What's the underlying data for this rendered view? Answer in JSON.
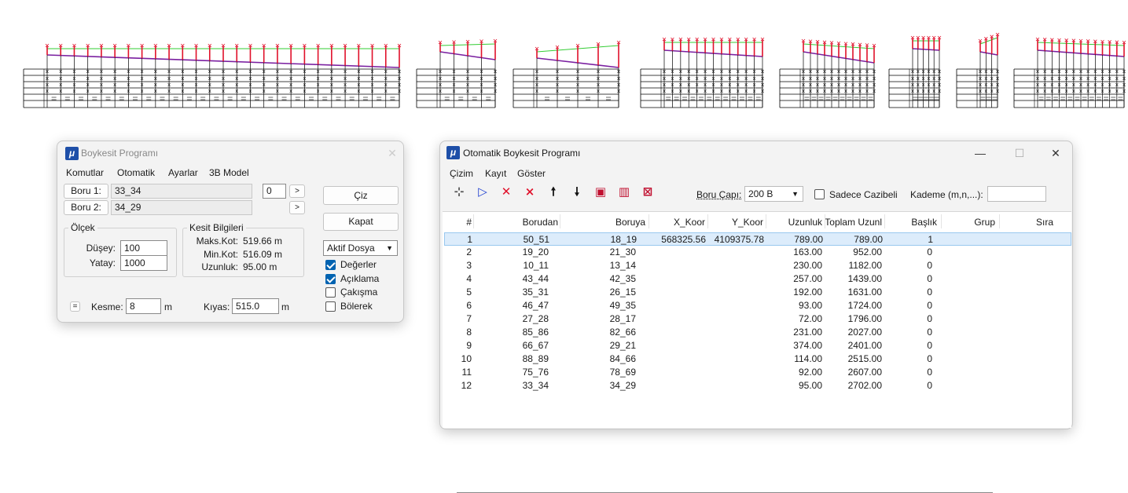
{
  "cad": {
    "line_color_terrain": "#33cc33",
    "line_color_pipe": "#7a1fa0",
    "marker_color": "#e0102a"
  },
  "boykesit": {
    "title": "Boykesit Programı",
    "icon_letter": "μ",
    "close_glyph": "✕",
    "menu": [
      "Komutlar",
      "Otomatik",
      "Ayarlar",
      "3B Model"
    ],
    "boru1_label": "Boru 1:",
    "boru1_value": "33_34",
    "boru2_label": "Boru 2:",
    "boru2_value": "34_29",
    "counter_value": "0",
    "next_glyph": ">",
    "ciz": "Çiz",
    "kapat": "Kapat",
    "olcek": {
      "title": "Ölçek",
      "duse_label": "Düşey:",
      "duse_value": "100",
      "yatay_label": "Yatay:",
      "yatay_value": "1000"
    },
    "kesit": {
      "title": "Kesit Bilgileri",
      "maks_label": "Maks.Kot:",
      "maks_value": "519.66 m",
      "min_label": "Min.Kot:",
      "min_value": "516.09 m",
      "uzun_label": "Uzunluk:",
      "uzun_value": "95.00 m"
    },
    "file_select": "Aktif Dosya",
    "checks": [
      {
        "label": "Değerler",
        "checked": true
      },
      {
        "label": "Açıklama",
        "checked": true
      },
      {
        "label": "Çakışma",
        "checked": false
      },
      {
        "label": "Bölerek",
        "checked": false
      }
    ],
    "eq_glyph": "=",
    "kesme_label": "Kesme:",
    "kesme_value": "8",
    "kesme_unit": "m",
    "kiyas_label": "Kıyas:",
    "kiyas_value": "515.0",
    "kiyas_unit": "m"
  },
  "otomatik": {
    "title": "Otomatik Boykesit Programı",
    "icon_letter": "μ",
    "min_glyph": "—",
    "max_glyph": "☐",
    "close_glyph": "✕",
    "menu": [
      "Çizim",
      "Kayıt",
      "Göster"
    ],
    "toolbar_icons": [
      {
        "name": "crosshair-icon",
        "glyph": "⊹",
        "color": "#555555"
      },
      {
        "name": "play-icon",
        "glyph": "▷",
        "color": "#1f3fd0"
      },
      {
        "name": "delete-x-icon",
        "glyph": "✕",
        "color": "#e0102a"
      },
      {
        "name": "delete-all-icon",
        "glyph": "⨯",
        "color": "#e0102a"
      },
      {
        "name": "arrow-up-icon",
        "glyph": "🠕",
        "color": "#111111"
      },
      {
        "name": "arrow-down-icon",
        "glyph": "🠗",
        "color": "#111111"
      },
      {
        "name": "profile-icon",
        "glyph": "▣",
        "color": "#c01030"
      },
      {
        "name": "profile-multi-icon",
        "glyph": "▥",
        "color": "#c01030"
      },
      {
        "name": "profile-delete-icon",
        "glyph": "⊠",
        "color": "#c01030"
      }
    ],
    "boru_capi_label": "Boru Çapı:",
    "boru_capi_value": "200 B",
    "sadece_label": "Sadece Cazibeli",
    "kademe_label": "Kademe (m,n,...):",
    "kademe_value": "",
    "columns": [
      "#",
      "Borudan",
      "Boruya",
      "X_Koor",
      "Y_Koor",
      "Uzunluk",
      "Toplam Uzunl",
      "Başlık",
      "Grup",
      "Sıra"
    ],
    "rows": [
      [
        "1",
        "50_51",
        "18_19",
        "568325.56",
        "4109375.78",
        "789.00",
        "789.00",
        "1",
        "",
        ""
      ],
      [
        "2",
        "19_20",
        "21_30",
        "",
        "",
        "163.00",
        "952.00",
        "0",
        "",
        ""
      ],
      [
        "3",
        "10_11",
        "13_14",
        "",
        "",
        "230.00",
        "1182.00",
        "0",
        "",
        ""
      ],
      [
        "4",
        "43_44",
        "42_35",
        "",
        "",
        "257.00",
        "1439.00",
        "0",
        "",
        ""
      ],
      [
        "5",
        "35_31",
        "26_15",
        "",
        "",
        "192.00",
        "1631.00",
        "0",
        "",
        ""
      ],
      [
        "6",
        "46_47",
        "49_35",
        "",
        "",
        "93.00",
        "1724.00",
        "0",
        "",
        ""
      ],
      [
        "7",
        "27_28",
        "28_17",
        "",
        "",
        "72.00",
        "1796.00",
        "0",
        "",
        ""
      ],
      [
        "8",
        "85_86",
        "82_66",
        "",
        "",
        "231.00",
        "2027.00",
        "0",
        "",
        ""
      ],
      [
        "9",
        "66_67",
        "29_21",
        "",
        "",
        "374.00",
        "2401.00",
        "0",
        "",
        ""
      ],
      [
        "10",
        "88_89",
        "84_66",
        "",
        "",
        "114.00",
        "2515.00",
        "0",
        "",
        ""
      ],
      [
        "11",
        "75_76",
        "78_69",
        "",
        "",
        "92.00",
        "2607.00",
        "0",
        "",
        ""
      ],
      [
        "12",
        "33_34",
        "34_29",
        "",
        "",
        "95.00",
        "2702.00",
        "0",
        "",
        ""
      ]
    ]
  }
}
